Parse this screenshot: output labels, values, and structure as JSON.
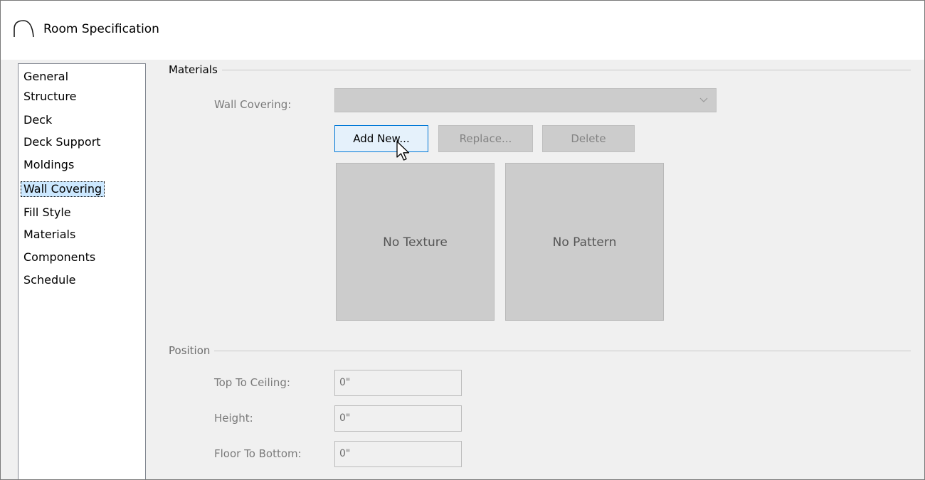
{
  "window": {
    "title": "Room Specification"
  },
  "nav": {
    "items": [
      {
        "label": "General"
      },
      {
        "label": "Structure"
      },
      {
        "label": "Deck"
      },
      {
        "label": "Deck Support"
      },
      {
        "label": "Moldings"
      },
      {
        "label": "Wall Covering",
        "selected": true
      },
      {
        "label": "Fill Style"
      },
      {
        "label": "Materials"
      },
      {
        "label": "Components"
      },
      {
        "label": "Schedule"
      }
    ]
  },
  "materials": {
    "group_label": "Materials",
    "wall_covering_label": "Wall Covering:",
    "wall_covering_value": "",
    "add_new_label": "Add New...",
    "replace_label": "Replace...",
    "delete_label": "Delete",
    "texture_label": "No Texture",
    "pattern_label": "No Pattern"
  },
  "position": {
    "group_label": "Position",
    "top_to_ceiling_label": "Top To Ceiling:",
    "top_to_ceiling_value": "0\"",
    "height_label": "Height:",
    "height_value": "0\"",
    "floor_to_bottom_label": "Floor To Bottom:",
    "floor_to_bottom_value": "0\""
  },
  "colors": {
    "selection": "#cce8ff",
    "focus_border": "#0078d7",
    "disabled_fill": "#cccccc"
  }
}
